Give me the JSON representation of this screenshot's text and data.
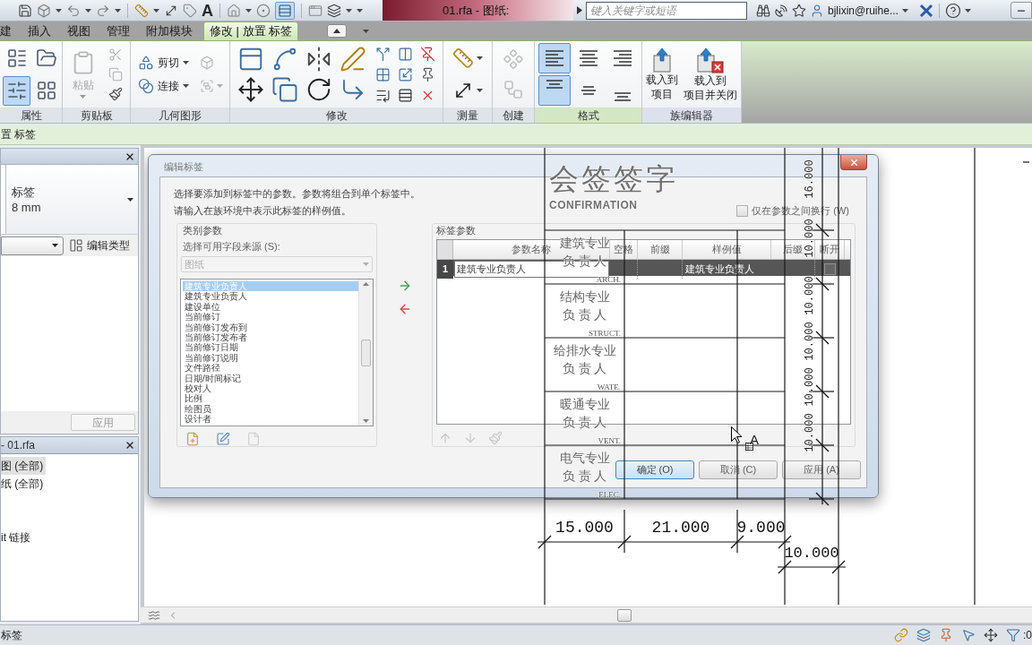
{
  "title_bar": {
    "text_tool": "A",
    "document_title": "01.rfa - 图纸:",
    "search": {
      "placeholder": "键入关键字或短语"
    },
    "user": "bjlixin@ruihe..."
  },
  "ribbon_tabs": [
    {
      "label": "建",
      "selected": false
    },
    {
      "label": "插入",
      "selected": false
    },
    {
      "label": "视图",
      "selected": false
    },
    {
      "label": "管理",
      "selected": false
    },
    {
      "label": "附加模块",
      "selected": false
    },
    {
      "label": "修改 | 放置 标签",
      "selected": true
    }
  ],
  "ribbon": {
    "properties": {
      "title": "属性",
      "buttons": [
        {
          "selected": false
        },
        {
          "selected": false
        },
        {
          "selected": true
        },
        {
          "selected": false
        }
      ]
    },
    "clipboard": {
      "title": "剪贴板",
      "paste": {
        "label": "粘贴",
        "disabled": true
      }
    },
    "geometry": {
      "title": "几何图形",
      "buttons": [
        {
          "label": "剪切"
        },
        {
          "label": "连接"
        }
      ]
    },
    "modify": {
      "title": "修改"
    },
    "measure": {
      "title": "测量"
    },
    "create": {
      "title": "创建"
    },
    "format": {
      "title": "格式",
      "buttons": [
        {
          "kind": "left",
          "selected": true
        },
        {
          "kind": "center",
          "selected": false
        },
        {
          "kind": "right",
          "selected": false
        },
        {
          "kind": "top",
          "selected": true
        },
        {
          "kind": "middle",
          "selected": false
        },
        {
          "kind": "bottom",
          "selected": false
        }
      ]
    },
    "family_editor": {
      "title": "族编辑器",
      "buttons": [
        {
          "kind": "load",
          "lines": [
            "载入到",
            "项目"
          ]
        },
        {
          "kind": "load_close",
          "lines": [
            "载入到",
            "项目并关闭"
          ]
        }
      ]
    }
  },
  "options_bar": {
    "label": "置 标签"
  },
  "properties_palette": {
    "type_name": "标签",
    "type_size": "8 mm",
    "edit_type": "编辑类型",
    "apply": {
      "label": "应用",
      "disabled": true
    }
  },
  "project_browser": {
    "title": "- 01.rfa",
    "items": [
      {
        "label": "图 (全部)",
        "selected": true
      },
      {
        "label": "纸 (全部)",
        "selected": false
      },
      {
        "label": "it 链接",
        "selected": false
      }
    ]
  },
  "dialog": {
    "title": "编辑标签",
    "instructions": [
      "选择要添加到标签中的参数。参数将组合到单个标签中。",
      "请输入在族环境中表示此标签的样例值。"
    ],
    "category_parameters": {
      "title": "类别参数",
      "source_label": "选择可用字段来源 (S):",
      "source": {
        "value": "图纸",
        "disabled": true
      },
      "fields": [
        {
          "label": "建筑专业负责人",
          "selected": true
        },
        {
          "label": "建筑专业负责人",
          "selected": false
        },
        {
          "label": "建设单位",
          "selected": false
        },
        {
          "label": "当前修订",
          "selected": false
        },
        {
          "label": "当前修订发布到",
          "selected": false
        },
        {
          "label": "当前修订发布者",
          "selected": false
        },
        {
          "label": "当前修订日期",
          "selected": false
        },
        {
          "label": "当前修订说明",
          "selected": false
        },
        {
          "label": "文件路径",
          "selected": false
        },
        {
          "label": "日期/时间标记",
          "selected": false
        },
        {
          "label": "校对人",
          "selected": false
        },
        {
          "label": "比例",
          "selected": false
        },
        {
          "label": "绘图员",
          "selected": false
        },
        {
          "label": "设计者",
          "selected": false
        }
      ]
    },
    "label_parameters": {
      "title": "标签参数",
      "wrap_option": {
        "label": "仅在参数之间换行 (W)",
        "checked": false
      },
      "columns": [
        "参数名称",
        "空格",
        "前缀",
        "样例值",
        "后缀",
        "断开"
      ],
      "rows": [
        {
          "number": "1",
          "name": "建筑专业负责人",
          "sample_value": "建筑专业负责人",
          "break": false,
          "selected": true
        }
      ]
    },
    "buttons": [
      {
        "label": "确定 (O)",
        "default": true
      },
      {
        "label": "取消 (C)",
        "default": false
      },
      {
        "label": "应用 (A)",
        "default": false
      }
    ]
  },
  "drawing": {
    "title": "会签签字",
    "subtitle": "CONFIRMATION",
    "rows": [
      {
        "discipline": "建筑专业",
        "role": "负 责 人",
        "code": "ARCH."
      },
      {
        "discipline": "结构专业",
        "role": "负 责 人",
        "code": "STRUCT."
      },
      {
        "discipline": "给排水专业",
        "role": "负 责 人",
        "code": "WATE."
      },
      {
        "discipline": "暖通专业",
        "role": "负 责 人",
        "code": "VENT."
      },
      {
        "discipline": "电气专业",
        "role": "负 责 人",
        "code": "ELEC."
      }
    ],
    "vertical_dimensions": [
      "16.000",
      "10.000",
      "10.000",
      "10.000",
      "10.000",
      "10.000"
    ],
    "horizontal_dimensions": [
      "15.000",
      "21.000",
      "9.000"
    ],
    "lower_dimension": "10.000"
  },
  "cursor": {
    "badge": "A"
  },
  "status_bar": {
    "text": "标签",
    "filter_count": ":0"
  }
}
